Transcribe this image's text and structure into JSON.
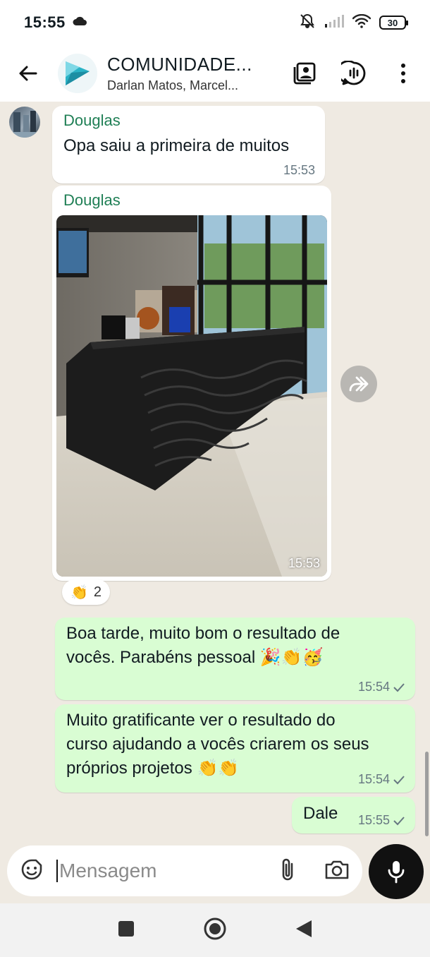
{
  "status_bar": {
    "time": "15:55",
    "battery": "30"
  },
  "header": {
    "title": "COMUNIDADE...",
    "subtitle": "Darlan Matos, Marcel..."
  },
  "messages": [
    {
      "sender": "Douglas",
      "text": "Opa saiu a primeira de muitos",
      "time": "15:53"
    },
    {
      "sender": "Douglas",
      "type": "image",
      "time": "15:53",
      "reaction_count": "2"
    },
    {
      "text_line1": "Boa tarde, muito bom o resultado de",
      "text_line2": "vocês. Parabéns pessoal",
      "time": "15:54"
    },
    {
      "text_line1": "Muito gratificante ver o resultado do",
      "text_line2": "curso ajudando a vocês criarem os seus",
      "text_line3": "próprios projetos",
      "time": "15:54"
    },
    {
      "text": "Dale",
      "time": "15:55"
    }
  ],
  "composer": {
    "placeholder": "Mensagem"
  },
  "colors": {
    "outgoing_bubble": "#d9fdd3",
    "sender_name": "#1f7f55",
    "chat_bg": "#efeae2"
  }
}
